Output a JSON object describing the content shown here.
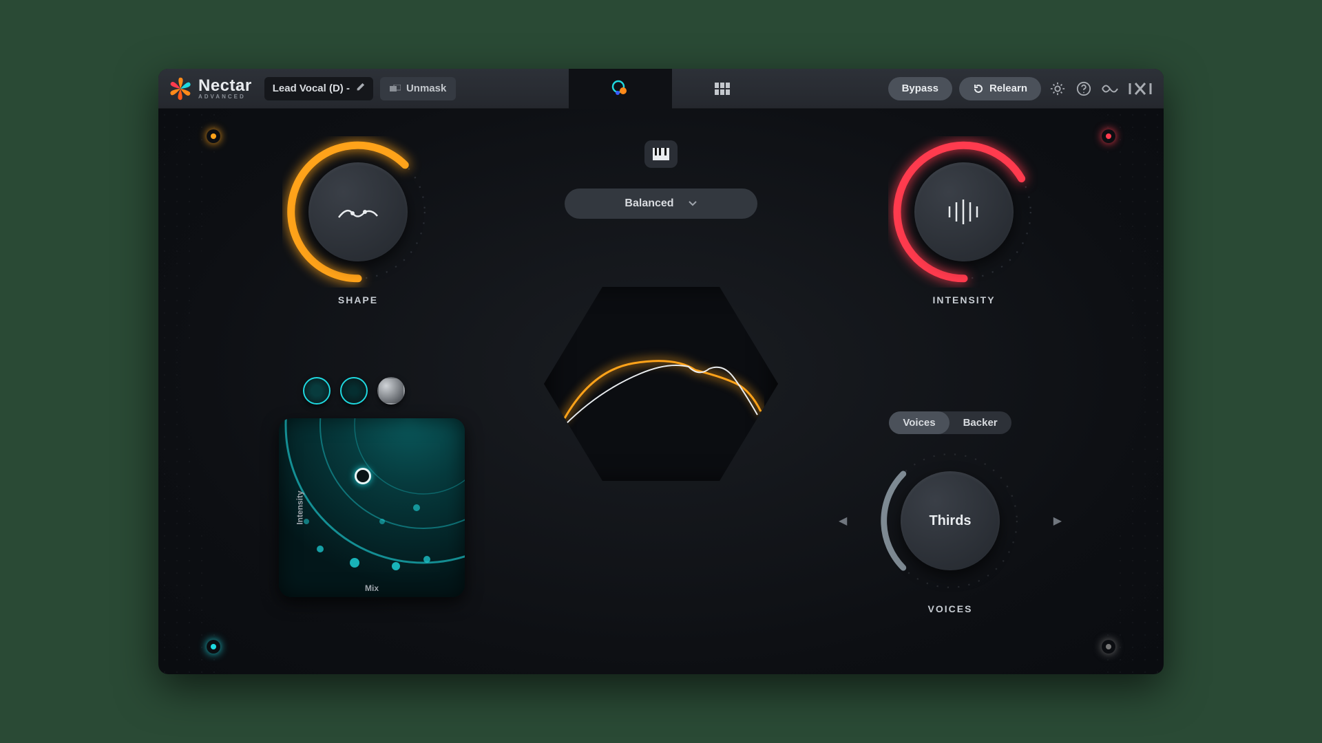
{
  "product": {
    "name": "Nectar",
    "edition": "ADVANCED"
  },
  "header": {
    "preset_name": "Lead Vocal (D) -",
    "unmask_label": "Unmask",
    "bypass_label": "Bypass",
    "relearn_label": "Relearn"
  },
  "icons": {
    "assistant": "assistant-view",
    "modules": "modules-view",
    "keyboard": "keyboard",
    "settings": "gear",
    "help": "help",
    "audiolens": "audiolens",
    "brand": "izotope-logo"
  },
  "mode": {
    "selected": "Balanced"
  },
  "knobs": {
    "shape": {
      "label": "SHAPE",
      "arc_pct": 70,
      "color": "#ffa31a"
    },
    "intensity": {
      "label": "INTENSITY",
      "arc_pct": 78,
      "color": "#ff3b4e"
    },
    "voices": {
      "label": "VOICES",
      "value": "Thirds",
      "arc_pct": 40,
      "color": "#5f6b74"
    }
  },
  "voices_tabs": {
    "active": "Voices",
    "other": "Backer"
  },
  "xy_pad": {
    "x_label": "Mix",
    "y_label": "Intensity"
  },
  "space_presets": [
    "teal-ambient",
    "teal-wide",
    "metal"
  ],
  "power": {
    "shape": true,
    "intensity": true,
    "space": true,
    "voices": false
  }
}
